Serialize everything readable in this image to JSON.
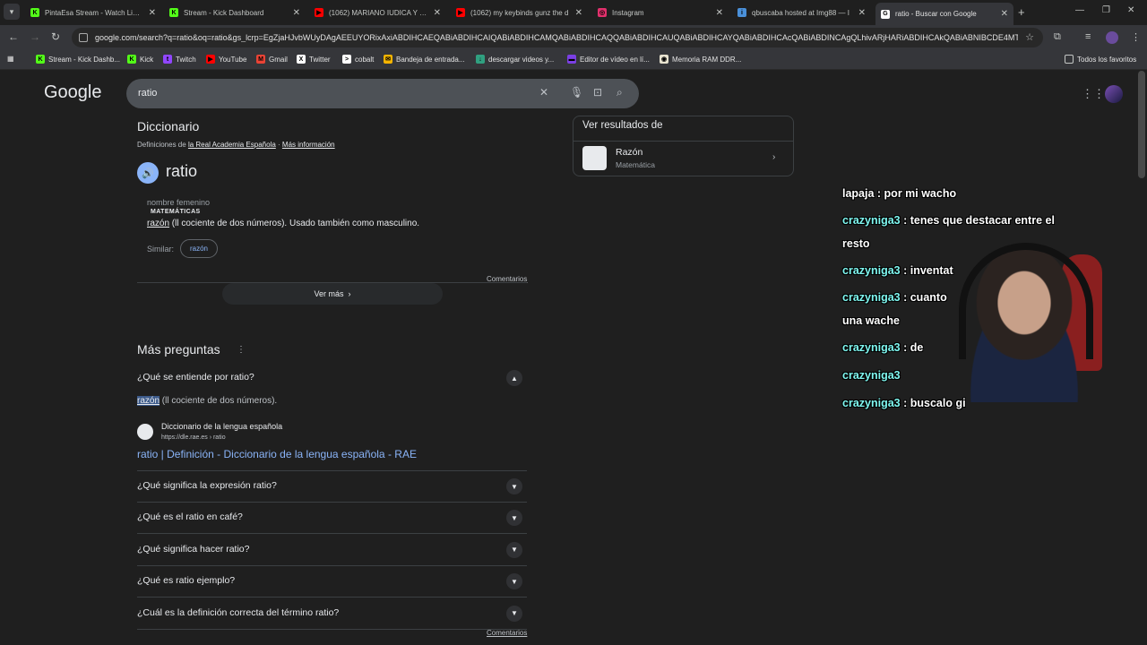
{
  "browser": {
    "tabs": [
      {
        "title": "PintaEsa Stream - Watch Live o",
        "color": "#53fc18",
        "letter": "K"
      },
      {
        "title": "Stream - Kick Dashboard",
        "color": "#53fc18",
        "letter": "K"
      },
      {
        "title": "(1062) MARIANO IUDICA Y LA",
        "color": "#ff0000",
        "letter": "▶"
      },
      {
        "title": "(1062) my keybinds gunz the d",
        "color": "#ff0000",
        "letter": "▶"
      },
      {
        "title": "Instagram",
        "color": "#e1306c",
        "letter": "◎"
      },
      {
        "title": "qbuscaba hosted at Img88 — I",
        "color": "#4a90d9",
        "letter": "i"
      },
      {
        "title": "ratio - Buscar con Google",
        "color": "#ffffff",
        "letter": "G"
      }
    ],
    "url": "google.com/search?q=ratio&oq=ratio&gs_lcrp=EgZjaHJvbWUyDAgAEEUYORixAxiABDIHCAEQABiABDIHCAIQABiABDIHCAMQABiABDIHCAQQABiABDIHCAUQABiABDIHCAYQABiABDIHCAcQABiABDINCAgQLhivARjHARiABDIHCAkQABiABNIBCDE4MT...",
    "bookmarks": [
      {
        "label": "Stream - Kick Dashb...",
        "color": "#53fc18",
        "letter": "K"
      },
      {
        "label": "Kick",
        "color": "#53fc18",
        "letter": "K"
      },
      {
        "label": "Twitch",
        "color": "#9146ff",
        "letter": "t"
      },
      {
        "label": "YouTube",
        "color": "#ff0000",
        "letter": "▶"
      },
      {
        "label": "Gmail",
        "color": "#ea4335",
        "letter": "M"
      },
      {
        "label": "Twitter",
        "color": "#ffffff",
        "letter": "X"
      },
      {
        "label": "cobalt",
        "color": "#ffffff",
        "letter": ">"
      },
      {
        "label": "Bandeja de entrada...",
        "color": "#f5b400",
        "letter": "✉"
      },
      {
        "label": "descargar videos y...",
        "color": "#30a080",
        "letter": "↓"
      },
      {
        "label": "Editor de vídeo en lí...",
        "color": "#7b3fe4",
        "letter": "▬"
      },
      {
        "label": "Memoria RAM DDR...",
        "color": "#e8e3d0",
        "letter": "◉"
      }
    ],
    "all_bookmarks": "Todos los favoritos"
  },
  "google": {
    "logo": "Google",
    "query": "ratio",
    "dictionary": {
      "title": "Diccionario",
      "source_prefix": "Definiciones de",
      "source_name": "la Real Academia Española",
      "source_sep": "·",
      "more_info": "Más información",
      "word": "ratio",
      "grammar": "nombre femenino",
      "field": "MATEMÁTICAS",
      "def_link": "razón",
      "def_text": " (ll cociente de dos números). Usado también como masculino.",
      "similar_label": "Similar:",
      "similar_chip": "razón",
      "feedback": "Comentarios",
      "see_more": "Ver más"
    },
    "paa": {
      "title": "Más preguntas",
      "open_question": "¿Qué se entiende por ratio?",
      "answer_hl": "razón",
      "answer_rest": " (ll cociente de dos números).",
      "source_name": "Diccionario de la lengua española",
      "source_url": "https://dle.rae.es › ratio",
      "source_link": "ratio | Definición - Diccionario de la lengua española - RAE",
      "questions": [
        "¿Qué significa la expresión ratio?",
        "¿Qué es el ratio en café?",
        "¿Qué significa hacer ratio?",
        "¿Qué es ratio ejemplo?",
        "¿Cuál es la definición correcta del término ratio?"
      ],
      "feedback": "Comentarios"
    },
    "knowledge": {
      "title": "Ver resultados de",
      "name": "Razón",
      "subtitle": "Matemática"
    }
  },
  "stream_chat": [
    {
      "user": "",
      "msg": "lapaja : por mi wacho"
    },
    {
      "user": "crazyniga3",
      "msg": " : tenes que destacar entre el"
    },
    {
      "user": "",
      "msg": "resto"
    },
    {
      "user": "crazyniga3",
      "msg": " : inventat"
    },
    {
      "user": "crazyniga3",
      "msg": " : cuanto"
    },
    {
      "user": "",
      "msg": "una wache"
    },
    {
      "user": "crazyniga3",
      "msg": " : de"
    },
    {
      "user": "crazyniga3",
      "msg": ""
    },
    {
      "user": "crazyniga3",
      "msg": " : buscalo gi"
    }
  ]
}
